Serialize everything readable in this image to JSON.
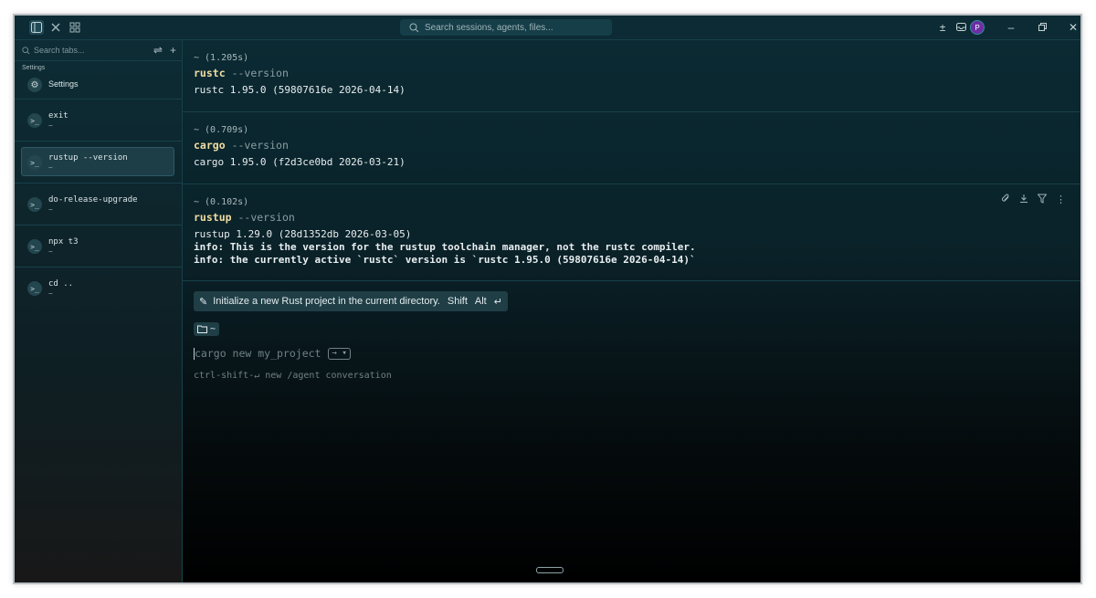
{
  "titlebar": {
    "search_placeholder": "Search sessions, agents, files...",
    "avatar_letter": "P"
  },
  "sidebar": {
    "search_placeholder": "Search tabs...",
    "section_label": "Settings",
    "settings_item": {
      "label": "Settings",
      "icon": "gear-icon"
    },
    "items": [
      {
        "label": "exit",
        "sub": "~",
        "selected": false
      },
      {
        "label": "rustup --version",
        "sub": "~",
        "selected": true
      },
      {
        "label": "do-release-upgrade",
        "sub": "~",
        "selected": false
      },
      {
        "label": "npx t3",
        "sub": "~",
        "selected": false
      },
      {
        "label": "cd ..",
        "sub": "~",
        "selected": false
      }
    ]
  },
  "blocks": [
    {
      "time": "~ (1.205s)",
      "cmd": "rustc",
      "flag": "--version",
      "output": [
        "rustc 1.95.0 (59807616e 2026-04-14)"
      ]
    },
    {
      "time": "~ (0.709s)",
      "cmd": "cargo",
      "flag": "--version",
      "output": [
        "cargo 1.95.0 (f2d3ce0bd 2026-03-21)"
      ]
    },
    {
      "time": "~ (0.102s)",
      "cmd": "rustup",
      "flag": "--version",
      "output": [
        "rustup 1.29.0 (28d1352db 2026-03-05)",
        "info: This is the version for the rustup toolchain manager, not the rustc compiler.",
        "info: the currently active `rustc` version is `rustc 1.95.0 (59807616e 2026-04-14)`"
      ]
    }
  ],
  "suggestion": {
    "text": "Initialize a new Rust project in the current directory.",
    "key1": "Shift",
    "key2": "Alt",
    "key3": "↵"
  },
  "folder_label": "~",
  "prompt": {
    "placeholder": "cargo new my_project",
    "arrow": "→ ▾"
  },
  "hint": "ctrl-shift-↵ new /agent conversation"
}
